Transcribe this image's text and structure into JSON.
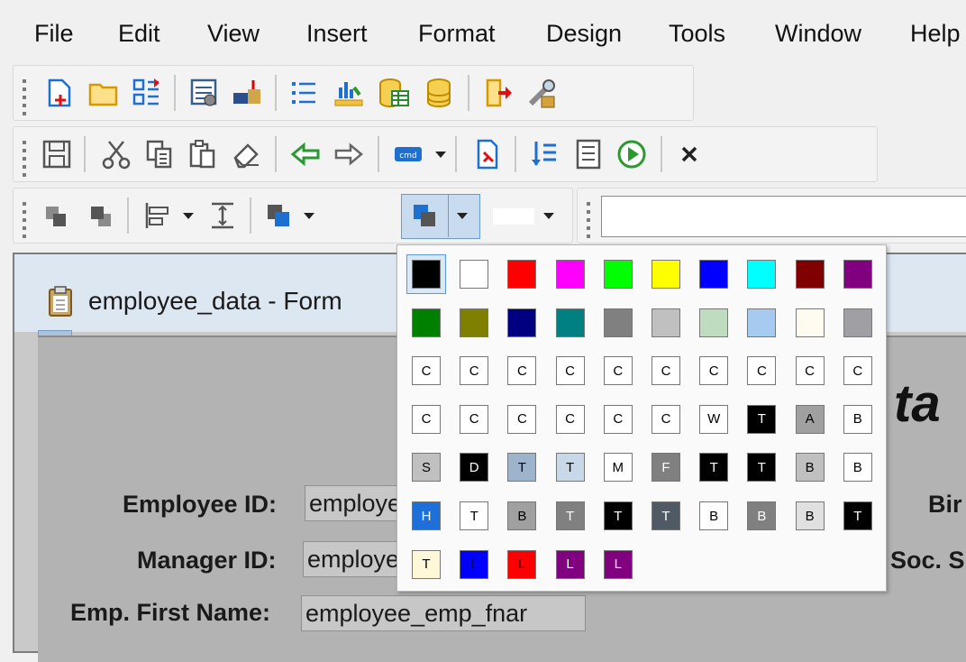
{
  "menu": {
    "items": [
      {
        "label": "File"
      },
      {
        "label": "Edit"
      },
      {
        "label": "View"
      },
      {
        "label": "Insert"
      },
      {
        "label": "Format"
      },
      {
        "label": "Design"
      },
      {
        "label": "Tools"
      },
      {
        "label": "Window"
      },
      {
        "label": "Help"
      }
    ]
  },
  "form_window": {
    "title": "employee_data - Form",
    "heading_partial": "ta",
    "fields": [
      {
        "label": "Employee ID:",
        "value": "employee_emp_id"
      },
      {
        "label": "Manager ID:",
        "value": "employee_manager_id"
      },
      {
        "label": "Emp. First Name:",
        "value": "employee_emp_fnar"
      }
    ],
    "right_labels": [
      {
        "label": "Bir"
      },
      {
        "label": "Soc. S"
      }
    ]
  },
  "palette": {
    "colors_row1": [
      "#000000",
      "#ffffff",
      "#ff0000",
      "#ff00ff",
      "#00ff00",
      "#ffff00",
      "#0000ff",
      "#00ffff",
      "#800000",
      "#800080"
    ],
    "colors_row2": [
      "#008000",
      "#808000",
      "#000080",
      "#008080",
      "#808080",
      "#c0c0c0",
      "#c0dcc0",
      "#a6caf0",
      "#fffbf0",
      "#a0a0a4"
    ],
    "text_swatches": [
      [
        {
          "t": "C",
          "bg": "#ffffff",
          "fg": "#000000"
        },
        {
          "t": "C",
          "bg": "#ffffff",
          "fg": "#000000"
        },
        {
          "t": "C",
          "bg": "#ffffff",
          "fg": "#000000"
        },
        {
          "t": "C",
          "bg": "#ffffff",
          "fg": "#000000"
        },
        {
          "t": "C",
          "bg": "#ffffff",
          "fg": "#000000"
        },
        {
          "t": "C",
          "bg": "#ffffff",
          "fg": "#000000"
        },
        {
          "t": "C",
          "bg": "#ffffff",
          "fg": "#000000"
        },
        {
          "t": "C",
          "bg": "#ffffff",
          "fg": "#000000"
        },
        {
          "t": "C",
          "bg": "#ffffff",
          "fg": "#000000"
        },
        {
          "t": "C",
          "bg": "#ffffff",
          "fg": "#000000"
        }
      ],
      [
        {
          "t": "C",
          "bg": "#ffffff",
          "fg": "#000000"
        },
        {
          "t": "C",
          "bg": "#ffffff",
          "fg": "#000000"
        },
        {
          "t": "C",
          "bg": "#ffffff",
          "fg": "#000000"
        },
        {
          "t": "C",
          "bg": "#ffffff",
          "fg": "#000000"
        },
        {
          "t": "C",
          "bg": "#ffffff",
          "fg": "#000000"
        },
        {
          "t": "C",
          "bg": "#ffffff",
          "fg": "#000000"
        },
        {
          "t": "W",
          "bg": "#ffffff",
          "fg": "#000000"
        },
        {
          "t": "T",
          "bg": "#000000",
          "fg": "#ffffff"
        },
        {
          "t": "A",
          "bg": "#a0a0a0",
          "fg": "#000000"
        },
        {
          "t": "B",
          "bg": "#ffffff",
          "fg": "#000000"
        }
      ],
      [
        {
          "t": "S",
          "bg": "#c0c0c0",
          "fg": "#000000"
        },
        {
          "t": "D",
          "bg": "#000000",
          "fg": "#ffffff"
        },
        {
          "t": "T",
          "bg": "#9db4cc",
          "fg": "#000000"
        },
        {
          "t": "T",
          "bg": "#c8d8e8",
          "fg": "#000000"
        },
        {
          "t": "M",
          "bg": "#ffffff",
          "fg": "#000000"
        },
        {
          "t": "F",
          "bg": "#808080",
          "fg": "#ffffff"
        },
        {
          "t": "T",
          "bg": "#000000",
          "fg": "#ffffff"
        },
        {
          "t": "T",
          "bg": "#000000",
          "fg": "#ffffff"
        },
        {
          "t": "B",
          "bg": "#c0c0c0",
          "fg": "#000000"
        },
        {
          "t": "B",
          "bg": "#ffffff",
          "fg": "#000000"
        }
      ],
      [
        {
          "t": "H",
          "bg": "#1e6fd9",
          "fg": "#ffffff"
        },
        {
          "t": "T",
          "bg": "#ffffff",
          "fg": "#000000"
        },
        {
          "t": "B",
          "bg": "#a0a0a0",
          "fg": "#000000"
        },
        {
          "t": "T",
          "bg": "#808080",
          "fg": "#ffffff"
        },
        {
          "t": "T",
          "bg": "#000000",
          "fg": "#ffffff"
        },
        {
          "t": "T",
          "bg": "#505a64",
          "fg": "#ffffff"
        },
        {
          "t": "B",
          "bg": "#ffffff",
          "fg": "#000000"
        },
        {
          "t": "B",
          "bg": "#808080",
          "fg": "#ffffff"
        },
        {
          "t": "B",
          "bg": "#e0e0e0",
          "fg": "#000000"
        },
        {
          "t": "T",
          "bg": "#000000",
          "fg": "#ffffff"
        }
      ],
      [
        {
          "t": "T",
          "bg": "#fff8d8",
          "fg": "#000000"
        },
        {
          "t": "L",
          "bg": "#0000ff",
          "fg": "#000000"
        },
        {
          "t": "L",
          "bg": "#ff0000",
          "fg": "#000000"
        },
        {
          "t": "L",
          "bg": "#800080",
          "fg": "#ffffff"
        },
        {
          "t": "L",
          "bg": "#800080",
          "fg": "#ffffff"
        }
      ]
    ]
  },
  "toolbar_icons": {
    "row1": [
      "new-form-icon",
      "open-folder-icon",
      "form-layout-icon",
      "data-sources-icon",
      "import-icon",
      "list-icon",
      "chart-icon",
      "table-database-icon",
      "database-icon",
      "exit-icon",
      "tools-key-icon"
    ],
    "row2": [
      "save-icon",
      "cut-icon",
      "copy-icon",
      "paste-icon",
      "eraser-icon",
      "undo-icon",
      "redo-icon",
      "command-icon",
      "report-preview-icon",
      "sort-list-icon",
      "properties-icon",
      "run-form-icon",
      "close-icon"
    ],
    "row3": [
      "bring-to-front-icon",
      "send-to-back-icon",
      "align-left-icon",
      "align-vertical-icon",
      "fill-color-icon",
      "line-color-icon",
      "font-color-icon"
    ]
  }
}
